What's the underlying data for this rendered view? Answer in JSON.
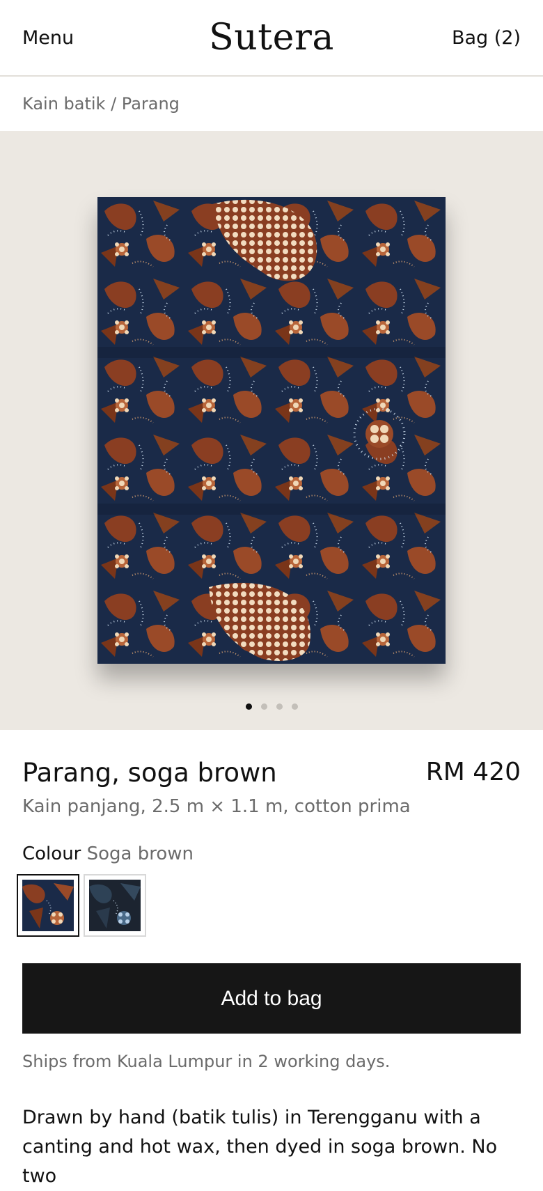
{
  "header": {
    "menu_label": "Menu",
    "brand": "Sutera",
    "bag_label": "Bag (2)"
  },
  "breadcrumb": "Kain batik / Parang",
  "gallery": {
    "slide_count": 4,
    "active_index": 0
  },
  "product": {
    "title": "Parang, soga brown",
    "price": "RM 420",
    "subtitle": "Kain panjang, 2.5 m × 1.1 m, cotton prima",
    "colour_label": "Colour",
    "colour_value": "Soga brown",
    "swatches": [
      {
        "name": "Soga brown",
        "selected": true
      },
      {
        "name": "Indigo",
        "selected": false
      }
    ],
    "add_to_bag_label": "Add to bag",
    "shipping_note": "Ships from Kuala Lumpur in 2 working days.",
    "description": "Drawn by hand (batik tulis) in Terengganu with a canting and hot wax, then dyed in soga brown. No two"
  },
  "colors": {
    "gallery_bg": "#ece8e2",
    "button_bg": "#161616",
    "muted_text": "#6b6b6b",
    "batik_navy": "#1a2a48",
    "batik_brown": "#9a4a28"
  }
}
